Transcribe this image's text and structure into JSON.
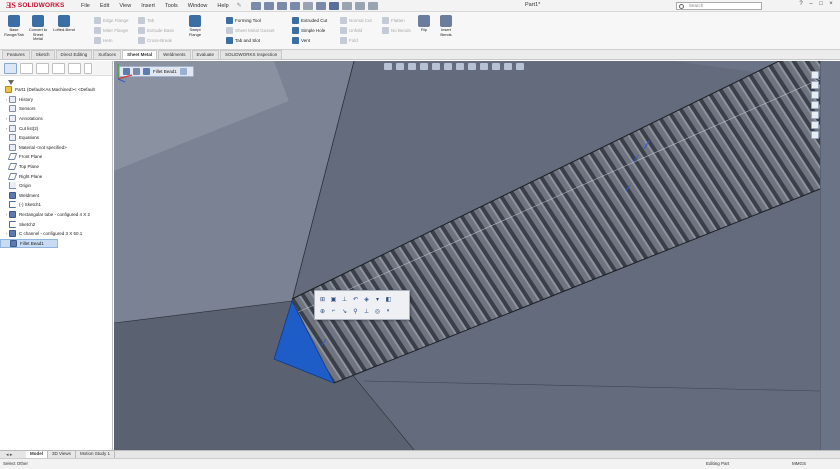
{
  "app": {
    "logo": "SOLIDWORKS",
    "doc_title": "Part1*"
  },
  "menu": [
    "File",
    "Edit",
    "View",
    "Insert",
    "Tools",
    "Window",
    "Help"
  ],
  "search": {
    "placeholder": "Search"
  },
  "window_controls": [
    "?",
    "–",
    "□",
    "×"
  ],
  "ribbon": {
    "big_buttons": [
      {
        "label": "Base Flange/Tab"
      },
      {
        "label": "Convert to Sheet Metal"
      },
      {
        "label": "Lofted-Bend"
      }
    ],
    "col1": [
      "Edge Flange",
      "Miter Flange",
      "Hem"
    ],
    "col2": [
      "Tab",
      "Extrude Base",
      "Cross-Break"
    ],
    "col3_big": "Swept Flange",
    "col4": [
      "Forming Tool",
      "Sheet Metal Gusset",
      "Tab and Slot"
    ],
    "col5": [
      "Extruded Cut",
      "Simple Hole",
      "Vent"
    ],
    "col6": [
      "Normal Cut",
      "Unfold",
      "Fold"
    ],
    "col7": [
      "Flatten",
      "No Bends"
    ],
    "col8_big": [
      "Rip",
      "Insert Bends"
    ]
  },
  "tabs": [
    "Features",
    "Sketch",
    "Direct Editing",
    "Surfaces",
    "Sheet Metal",
    "Weldments",
    "Evaluate",
    "SOLIDWORKS Inspection"
  ],
  "active_tab": "Sheet Metal",
  "tree": {
    "root": "Part1 (Default<As Machined>< <Default",
    "items": [
      {
        "label": "History",
        "icon": "history-icon",
        "expandable": true
      },
      {
        "label": "Sensors",
        "icon": "sensor-icon",
        "expandable": false
      },
      {
        "label": "Annotations",
        "icon": "annotation-icon",
        "expandable": true
      },
      {
        "label": "Cut list(2)",
        "icon": "cutlist-icon",
        "expandable": true
      },
      {
        "label": "Equations",
        "icon": "equation-icon",
        "expandable": false
      },
      {
        "label": "Material <not specified>",
        "icon": "material-icon",
        "expandable": false
      },
      {
        "label": "Front Plane",
        "icon": "plane-icon",
        "expandable": false
      },
      {
        "label": "Top Plane",
        "icon": "plane-icon",
        "expandable": false
      },
      {
        "label": "Right Plane",
        "icon": "plane-icon",
        "expandable": false
      },
      {
        "label": "Origin",
        "icon": "origin-icon",
        "expandable": false
      },
      {
        "label": "Weldment",
        "icon": "weldment-icon",
        "expandable": false
      },
      {
        "label": "(-) Sketch1",
        "icon": "sketch-icon",
        "expandable": false
      },
      {
        "label": "Rectangular tube - configured 4 X 2",
        "icon": "structural-member-icon",
        "expandable": true
      },
      {
        "label": "Sketch2",
        "icon": "sketch-icon",
        "expandable": false
      },
      {
        "label": "C channel - configured 3 X 50.1",
        "icon": "structural-member-icon",
        "expandable": true
      },
      {
        "label": "Fillet Bead1",
        "icon": "fillet-bead-icon",
        "expandable": false,
        "selected": true
      }
    ]
  },
  "breadcrumb": {
    "label": "Fillet Bead1"
  },
  "bottom_tabs": [
    "Model",
    "3D Views",
    "Motion Study 1"
  ],
  "status": {
    "left": "Select Other",
    "mode": "Editing Part",
    "units": "MMGS"
  },
  "colors": {
    "viewport_bg": "#6b7486",
    "selection": "#1e5cc8",
    "accent": "#c8102e"
  }
}
